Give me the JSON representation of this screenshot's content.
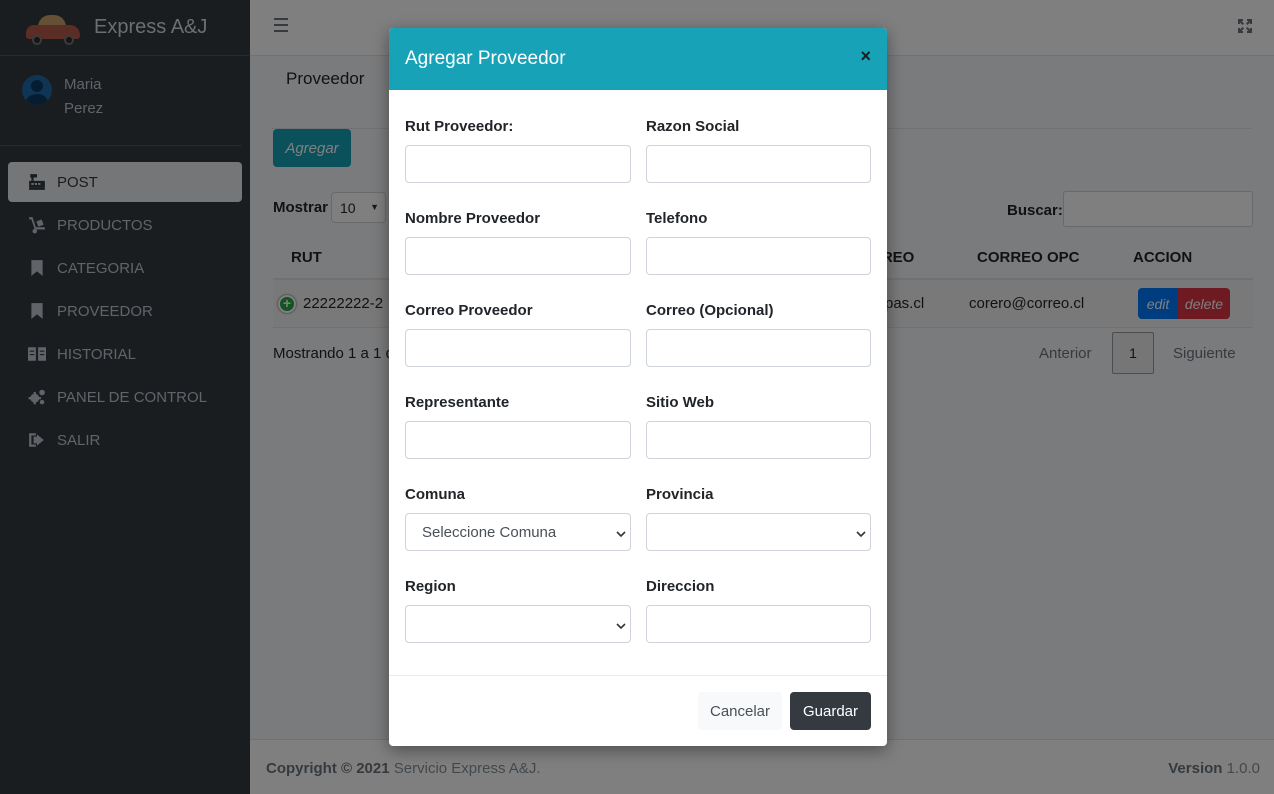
{
  "brand": {
    "name": "Express A&J"
  },
  "user": {
    "first_name": "Maria",
    "last_name": "Perez"
  },
  "sidebar": {
    "items": [
      {
        "label": "POST",
        "icon": "cash-register-icon",
        "active": true
      },
      {
        "label": "PRODUCTOS",
        "icon": "dolly-icon"
      },
      {
        "label": "CATEGORIA",
        "icon": "bookmark-icon"
      },
      {
        "label": "PROVEEDOR",
        "icon": "bookmark-icon"
      },
      {
        "label": "HISTORIAL",
        "icon": "book-open-icon"
      },
      {
        "label": "PANEL DE CONTROL",
        "icon": "cogs-icon"
      },
      {
        "label": "SALIR",
        "icon": "sign-out-icon"
      }
    ]
  },
  "header": {
    "menu_icon": "hamburger-icon",
    "expand_icon": "expand-icon"
  },
  "page": {
    "title": "Proveedor",
    "add_button": "Agregar",
    "show_label": "Mostrar",
    "show_value": "10",
    "search_label": "Buscar:",
    "columns": [
      "RUT",
      "RREO",
      "CORREO OPC",
      "ACCION"
    ],
    "row": {
      "rut": "22222222-2",
      "correo_fragment": "pas.cl",
      "correo_opc": "corero@correo.cl",
      "edit_label": "edit",
      "delete_label": "delete"
    },
    "info": "Mostrando 1 a 1 d",
    "pagination": {
      "prev": "Anterior",
      "page": "1",
      "next": "Siguiente"
    }
  },
  "footer": {
    "copyright_bold": "Copyright © 2021",
    "copyright_rest": "Servicio Express A&J.",
    "version_bold": "Version",
    "version_value": "1.0.0"
  },
  "modal": {
    "title": "Agregar Proveedor",
    "close": "×",
    "fields": {
      "rut": "Rut Proveedor:",
      "razon": "Razon Social",
      "nombre": "Nombre Proveedor",
      "telefono": "Telefono",
      "correo": "Correo Proveedor",
      "correo_opc": "Correo (Opcional)",
      "representante": "Representante",
      "sitio": "Sitio Web",
      "comuna": "Comuna",
      "comuna_value": "Seleccione Comuna",
      "provincia": "Provincia",
      "region": "Region",
      "direccion": "Direccion"
    },
    "cancel": "Cancelar",
    "save": "Guardar"
  },
  "colors": {
    "accent": "#17a2b8",
    "sidebar": "#343a40",
    "edit": "#007bff",
    "delete": "#dc3545"
  }
}
